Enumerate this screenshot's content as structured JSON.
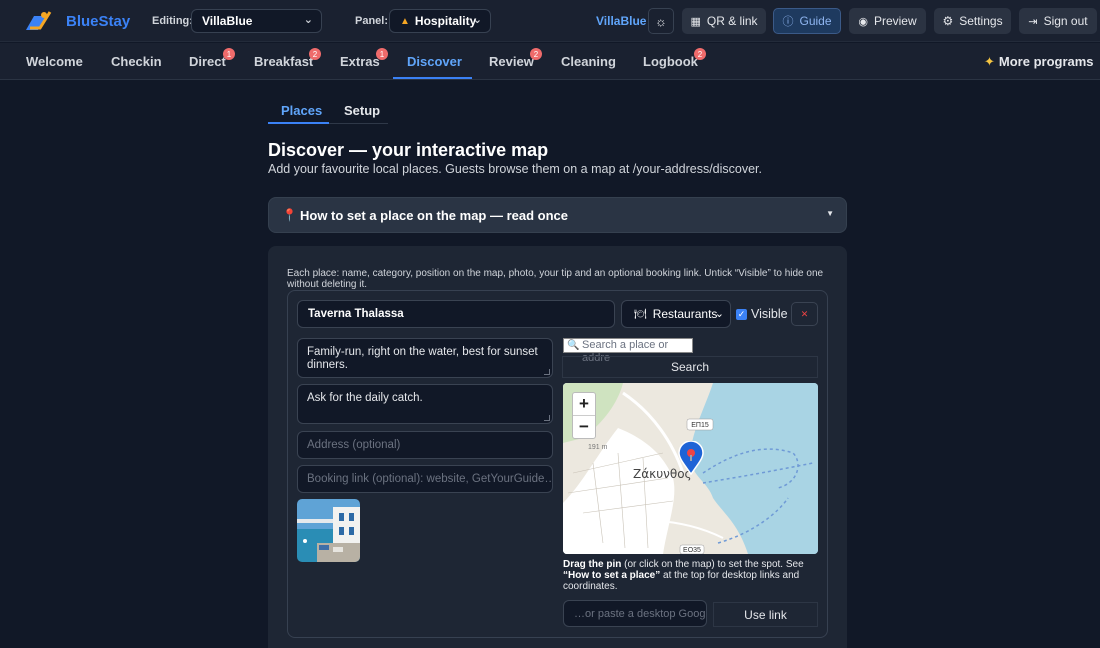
{
  "brand": {
    "name": "BlueStay"
  },
  "topbar": {
    "editing_label": "Editing:",
    "editing_value": "VillaBlue",
    "panel_label": "Panel:",
    "panel_value": "Hospitality",
    "villa_link": "VillaBlue",
    "qr_label": "QR & link",
    "guide_label": "Guide",
    "preview_label": "Preview",
    "settings_label": "Settings",
    "signout_label": "Sign out"
  },
  "nav": {
    "items": [
      {
        "label": "Welcome",
        "badge": ""
      },
      {
        "label": "Checkin",
        "badge": ""
      },
      {
        "label": "Direct",
        "badge": "1"
      },
      {
        "label": "Breakfast",
        "badge": "2"
      },
      {
        "label": "Extras",
        "badge": "1"
      },
      {
        "label": "Discover",
        "badge": ""
      },
      {
        "label": "Review",
        "badge": "2"
      },
      {
        "label": "Cleaning",
        "badge": ""
      },
      {
        "label": "Logbook",
        "badge": "2"
      }
    ],
    "more": "More programs"
  },
  "subtabs": [
    "Places",
    "Setup"
  ],
  "page": {
    "title": "Discover — your interactive map",
    "subtitle": "Add your favourite local places. Guests browse them on a map at /your-address/discover.",
    "accordion_title": "How to set a place on the map — read once",
    "note": "Each place: name, category, position on the map, photo, your tip and an optional booking link. Untick “Visible” to hide one without deleting it."
  },
  "place": {
    "name": "Taverna Thalassa",
    "category": "Restaurants",
    "visible_label": "Visible",
    "description": "Family-run, right on the water, best for sunset dinners.",
    "tip": "Ask for the daily catch.",
    "address_placeholder": "Address (optional)",
    "booking_placeholder": "Booking link (optional): website, GetYourGuide…"
  },
  "map": {
    "search_placeholder": "Search a place or addre",
    "search_button": "Search",
    "zoom_in": "+",
    "zoom_out": "−",
    "labels": {
      "town": "Ζάκυνθος",
      "road1": "ΕΠ15",
      "road2": "ΕΟ35",
      "height": "191 m"
    },
    "hint_strong1": "Drag the pin",
    "hint_text1": " (or click on the map) to set the spot. See ",
    "hint_strong2": "“How to set a place”",
    "hint_text2": " at the top for desktop links and coordinates.",
    "paste_placeholder": "…or paste a desktop Googl",
    "use_link": "Use link"
  },
  "colors": {
    "accent": "#3b82f6",
    "badge": "#ef6b6b",
    "background": "#111827"
  }
}
